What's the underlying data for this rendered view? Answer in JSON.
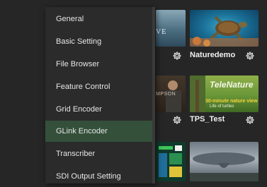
{
  "menu": {
    "items": [
      {
        "label": "General",
        "selected": false
      },
      {
        "label": "Basic Setting",
        "selected": false
      },
      {
        "label": "File Browser",
        "selected": false
      },
      {
        "label": "Feature Control",
        "selected": false
      },
      {
        "label": "Grid Encoder",
        "selected": false
      },
      {
        "label": "GLink Encoder",
        "selected": true
      },
      {
        "label": "Transcriber",
        "selected": false
      },
      {
        "label": "SDI Output Setting",
        "selected": false
      }
    ]
  },
  "grid": {
    "row1": {
      "left_thumb_text": "VE",
      "right_label": "Naturedemo"
    },
    "row2": {
      "left_thumb_text": "MPSON",
      "right_label": "TPS_Test",
      "right_thumb_title": "TeleNature",
      "right_thumb_subtitle": "30-minute nature view",
      "right_thumb_caption": "Life of turtles"
    }
  },
  "colors": {
    "background": "#262626",
    "menu_background": "#2b2b2b",
    "menu_selected": "#34503a",
    "text": "#e6e6e6"
  },
  "icons": [
    "gear-icon"
  ]
}
